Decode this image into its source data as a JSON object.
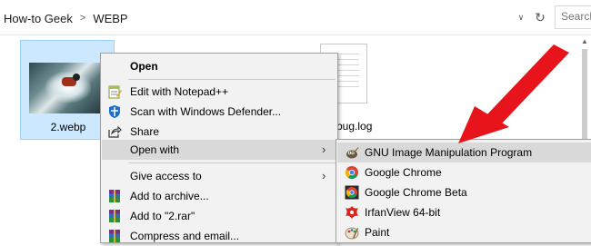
{
  "address_bar": {
    "crumbs": [
      "How-to Geek",
      "WEBP"
    ],
    "separator": ">",
    "dropdown_glyph": "∨",
    "refresh_glyph": "↻"
  },
  "search": {
    "placeholder": "Search"
  },
  "files": [
    {
      "name": "2.webp",
      "selected": true
    },
    {
      "name": "bug.log",
      "selected": false
    }
  ],
  "context_menu": {
    "items": [
      {
        "label": "Open",
        "bold": true,
        "icon": "none"
      },
      {
        "label": "Edit with Notepad++",
        "icon": "notepadpp-icon"
      },
      {
        "label": "Scan with Windows Defender...",
        "icon": "defender-shield-icon"
      },
      {
        "label": "Share",
        "icon": "share-icon"
      },
      {
        "label": "Open with",
        "icon": "none",
        "has_submenu": true,
        "highlighted": true
      },
      {
        "label": "Give access to",
        "icon": "none",
        "has_submenu": true
      },
      {
        "label": "Add to archive...",
        "icon": "winrar-icon"
      },
      {
        "label": "Add to \"2.rar\"",
        "icon": "winrar-icon"
      },
      {
        "label": "Compress and email...",
        "icon": "winrar-icon"
      }
    ],
    "chevron": "›"
  },
  "open_with_submenu": {
    "items": [
      {
        "label": "GNU Image Manipulation Program",
        "icon": "gimp-icon",
        "highlighted": true
      },
      {
        "label": "Google Chrome",
        "icon": "chrome-icon"
      },
      {
        "label": "Google Chrome Beta",
        "icon": "chrome-beta-icon"
      },
      {
        "label": "IrfanView 64-bit",
        "icon": "irfanview-icon"
      },
      {
        "label": "Paint",
        "icon": "paint-icon"
      }
    ]
  },
  "colors": {
    "selection_bg": "#cce8ff",
    "selection_border": "#99d1ff",
    "menu_bg": "#f2f2f2",
    "menu_highlight": "#d9d9d9",
    "annotation_arrow": "#e8141b"
  }
}
